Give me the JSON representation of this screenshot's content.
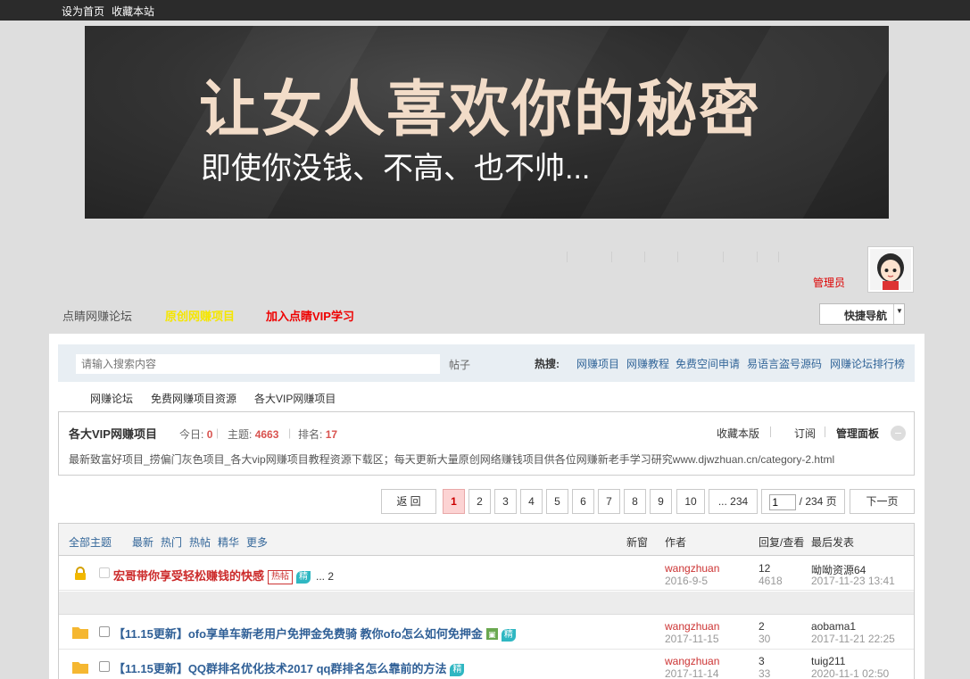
{
  "topbar": {
    "set_home": "设为首页",
    "bookmark": "收藏本站"
  },
  "banner": {
    "title": "让女人喜欢你的秘密",
    "subtitle": "即使你没钱、不高、也不帅..."
  },
  "user": {
    "role": "管理员"
  },
  "nav": {
    "forum": "点睛网赚论坛",
    "yellow_link": "原创网赚项目",
    "vip_link": "加入点睛VIP学习",
    "quick_nav": "快捷导航"
  },
  "search": {
    "placeholder": "请输入搜索内容",
    "type": "帖子",
    "hot_label": "热搜:",
    "hot_links": [
      "网赚项目",
      "网赚教程",
      "免费空间申请",
      "易语言盗号源码",
      "网赚论坛排行榜"
    ]
  },
  "subnav": [
    "网赚论坛",
    "免费网赚项目资源",
    "各大VIP网赚项目"
  ],
  "forum": {
    "title": "各大VIP网赚项目",
    "today_label": "今日:",
    "today": "0",
    "topics_label": "主题:",
    "topics": "4663",
    "rank_label": "排名:",
    "rank": "17",
    "actions": [
      "收藏本版",
      "订阅",
      "管理面板"
    ],
    "description": "最新致富好项目_捞偏门灰色项目_各大vip网赚项目教程资源下载区；每天更新大量原创网络赚钱项目供各位网赚新老手学习研究www.djwzhuan.cn/category-2.html"
  },
  "pagination": {
    "back": "返 回",
    "pages": [
      "1",
      "2",
      "3",
      "4",
      "5",
      "6",
      "7",
      "8",
      "9",
      "10",
      "... 234"
    ],
    "current": "1",
    "jump_value": "1",
    "total": "/ 234 页",
    "next": "下一页"
  },
  "thread_header": {
    "all": "全部主题",
    "filters": [
      "最新",
      "热门",
      "热帖",
      "精华",
      "更多"
    ],
    "new_window": "新窗",
    "author": "作者",
    "replies_views": "回复/查看",
    "last_post": "最后发表"
  },
  "threads": [
    {
      "title": "宏哥带你享受轻松赚钱的快感",
      "badges": [
        "热帖",
        "精"
      ],
      "pages": "... 2",
      "author": "wangzhuan",
      "date": "2016-9-5",
      "replies": "12",
      "views": "4618",
      "last_user": "呦呦资源64",
      "last_date": "2017-11-23 13:41"
    },
    {
      "title": "【11.15更新】ofo享单车新老用户免押金免费骑 教你ofo怎么如何免押金",
      "badges": [
        "精"
      ],
      "author": "wangzhuan",
      "date": "2017-11-15",
      "replies": "2",
      "views": "30",
      "last_user": "aobama1",
      "last_date": "2017-11-21 22:25"
    },
    {
      "title": "【11.15更新】QQ群排名优化技术2017 qq群排名怎么靠前的方法",
      "badges": [
        "精"
      ],
      "author": "wangzhuan",
      "date": "2017-11-14",
      "replies": "3",
      "views": "33",
      "last_user": "tuig211",
      "last_date": "2020-11-1 02:50"
    }
  ]
}
